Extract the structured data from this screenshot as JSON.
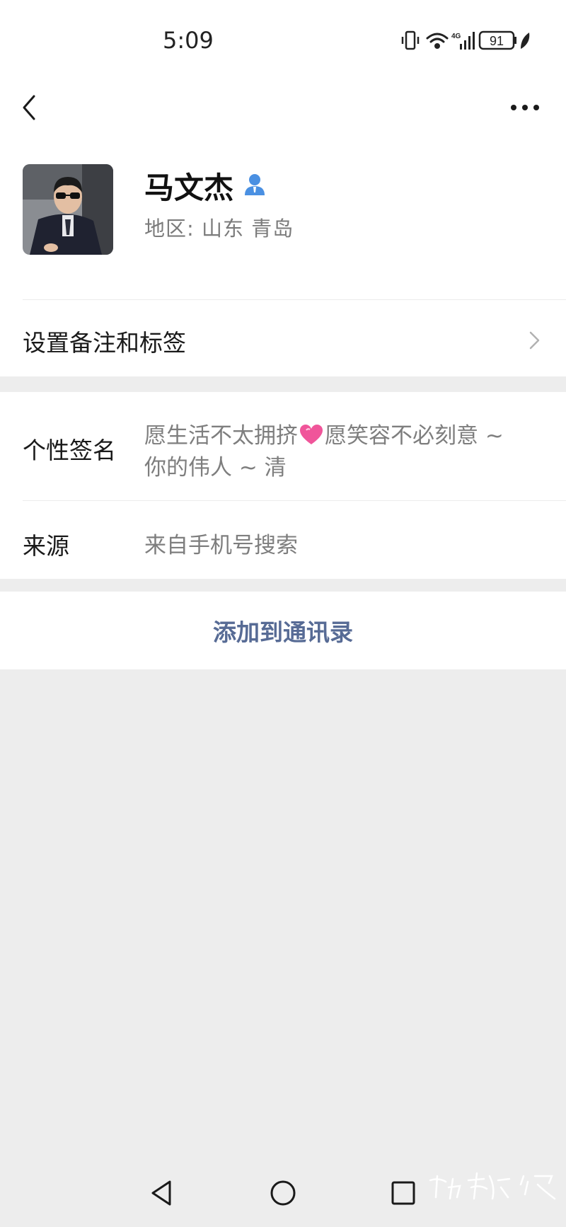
{
  "status_bar": {
    "time": "5:09",
    "battery": "91",
    "network": "4G",
    "icons": [
      "vibrate-icon",
      "wifi-icon",
      "signal-icon",
      "battery-icon",
      "leaf-icon"
    ]
  },
  "header": {
    "back_icon": "chevron-left-icon",
    "more_icon": "more-dots-icon"
  },
  "profile": {
    "name": "马文杰",
    "region": "地区:  山东  青岛"
  },
  "remark": {
    "label": "设置备注和标签"
  },
  "signature": {
    "label": "个性签名",
    "line1_a": "愿生活不太拥挤",
    "line1_b": "愿笑容不必刻意 ~",
    "line2": "你的伟人 ~ 清",
    "emoji": "heart-icon"
  },
  "source": {
    "label": "来源",
    "value": "来自手机号搜索"
  },
  "action": {
    "add_label": "添加到通讯录"
  },
  "colors": {
    "link": "#576b95",
    "background": "#ededed",
    "card": "#ffffff",
    "heart": "#f0559a"
  },
  "system_nav": [
    "back-triangle-icon",
    "home-circle-icon",
    "recents-square-icon"
  ],
  "watermark": "伊稀汇"
}
